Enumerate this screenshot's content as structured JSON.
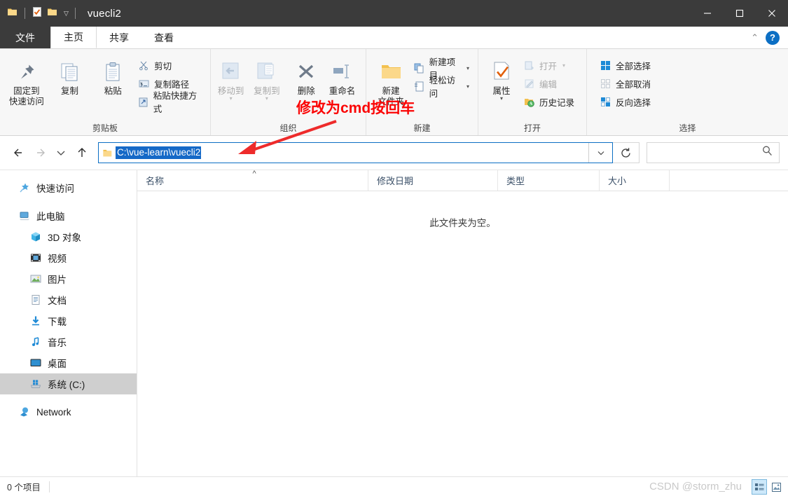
{
  "titlebar": {
    "title": "vuecli2",
    "quick_access_icons": [
      "folder-icon",
      "properties-check-icon",
      "new-folder-icon",
      "customize-caret-icon"
    ],
    "controls": [
      {
        "name": "minimize-button",
        "glyph": "minimize-icon"
      },
      {
        "name": "maximize-button",
        "glyph": "maximize-icon"
      },
      {
        "name": "close-button",
        "glyph": "close-icon"
      }
    ]
  },
  "tabs": [
    {
      "label": "文件",
      "kind": "file"
    },
    {
      "label": "主页",
      "kind": "active"
    },
    {
      "label": "共享",
      "kind": "normal"
    },
    {
      "label": "查看",
      "kind": "normal"
    }
  ],
  "tab_right": {
    "collapse": "⌃",
    "help": "?"
  },
  "ribbon": {
    "groups": [
      {
        "label": "剪贴板",
        "big": [
          {
            "label": "固定到\n快速访问",
            "icon": "pin-icon",
            "disabled": false
          },
          {
            "label": "复制",
            "icon": "copy-icon",
            "disabled": false
          },
          {
            "label": "粘贴",
            "icon": "paste-icon",
            "disabled": false
          }
        ],
        "small": [
          {
            "label": "剪切",
            "icon": "scissors-icon",
            "disabled": false
          },
          {
            "label": "复制路径",
            "icon": "copy-path-icon",
            "disabled": false
          },
          {
            "label": "粘贴快捷方式",
            "icon": "paste-shortcut-icon",
            "disabled": false
          }
        ]
      },
      {
        "label": "组织",
        "big": [
          {
            "label": "移动到",
            "icon": "move-to-icon",
            "disabled": true,
            "caret": true
          },
          {
            "label": "复制到",
            "icon": "copy-to-icon",
            "disabled": true,
            "caret": true
          },
          {
            "label": "删除",
            "icon": "delete-x-icon",
            "disabled": false,
            "caret": false
          },
          {
            "label": "重命名",
            "icon": "rename-icon",
            "disabled": false,
            "caret": false
          }
        ],
        "small": []
      },
      {
        "label": "新建",
        "big": [
          {
            "label": "新建\n文件夹",
            "icon": "new-folder-icon",
            "disabled": false
          }
        ],
        "small": [
          {
            "label": "新建项目",
            "icon": "new-item-icon",
            "disabled": false,
            "caret": true
          },
          {
            "label": "轻松访问",
            "icon": "easy-access-icon",
            "disabled": false,
            "caret": true
          }
        ]
      },
      {
        "label": "打开",
        "big": [
          {
            "label": "属性",
            "icon": "properties-check-icon",
            "disabled": false,
            "caret": true
          }
        ],
        "small": [
          {
            "label": "打开",
            "icon": "open-icon",
            "disabled": true,
            "caret": true
          },
          {
            "label": "编辑",
            "icon": "edit-pencil-icon",
            "disabled": true
          },
          {
            "label": "历史记录",
            "icon": "history-icon",
            "disabled": false
          }
        ]
      },
      {
        "label": "选择",
        "big": [],
        "small": [
          {
            "label": "全部选择",
            "icon": "select-all-icon",
            "disabled": false
          },
          {
            "label": "全部取消",
            "icon": "select-none-icon",
            "disabled": false
          },
          {
            "label": "反向选择",
            "icon": "invert-selection-icon",
            "disabled": false
          }
        ]
      }
    ]
  },
  "addressbar": {
    "back": "back-arrow-icon",
    "forward": "forward-arrow-icon",
    "recent": "recent-chevron-icon",
    "up": "up-arrow-icon",
    "path_value": "C:\\vue-learn\\vuecli2",
    "path_selected": true,
    "dropdown": "chevron-down-icon",
    "refresh": "refresh-icon",
    "search_placeholder": "",
    "search_value": "",
    "search_icon": "search-icon",
    "selection_color": "#1569c7",
    "border_color": "#0c6fc4"
  },
  "sidebar": {
    "items": [
      {
        "label": "快速访问",
        "icon": "star-pin-icon",
        "level": 0,
        "selected": false
      },
      {
        "label": "此电脑",
        "icon": "this-pc-icon",
        "level": 0,
        "selected": false
      },
      {
        "label": "3D 对象",
        "icon": "3d-objects-icon",
        "level": 1,
        "selected": false
      },
      {
        "label": "视频",
        "icon": "videos-icon",
        "level": 1,
        "selected": false
      },
      {
        "label": "图片",
        "icon": "pictures-icon",
        "level": 1,
        "selected": false
      },
      {
        "label": "文档",
        "icon": "documents-icon",
        "level": 1,
        "selected": false
      },
      {
        "label": "下载",
        "icon": "downloads-icon",
        "level": 1,
        "selected": false
      },
      {
        "label": "音乐",
        "icon": "music-icon",
        "level": 1,
        "selected": false
      },
      {
        "label": "桌面",
        "icon": "desktop-icon",
        "level": 1,
        "selected": false
      },
      {
        "label": "系统 (C:)",
        "icon": "drive-icon",
        "level": 1,
        "selected": true
      },
      {
        "label": "Network",
        "icon": "network-icon",
        "level": 0,
        "selected": false
      }
    ]
  },
  "filelist": {
    "columns": [
      {
        "label": "名称",
        "sorted": true,
        "sort_mark": "^"
      },
      {
        "label": "修改日期",
        "sorted": false
      },
      {
        "label": "类型",
        "sorted": false
      },
      {
        "label": "大小",
        "sorted": false
      }
    ],
    "rows": [],
    "empty_message": "此文件夹为空。"
  },
  "statusbar": {
    "item_count": "0 个项目",
    "watermark": "CSDN @storm_zhu",
    "views": [
      {
        "name": "details-view-button",
        "icon": "details-view-icon",
        "active": true
      },
      {
        "name": "large-icons-view-button",
        "icon": "large-icons-view-icon",
        "active": false
      }
    ]
  },
  "annotation": {
    "text": "修改为cmd按回车",
    "color": "#fb0505",
    "arrow_color": "#ee2b2b"
  }
}
